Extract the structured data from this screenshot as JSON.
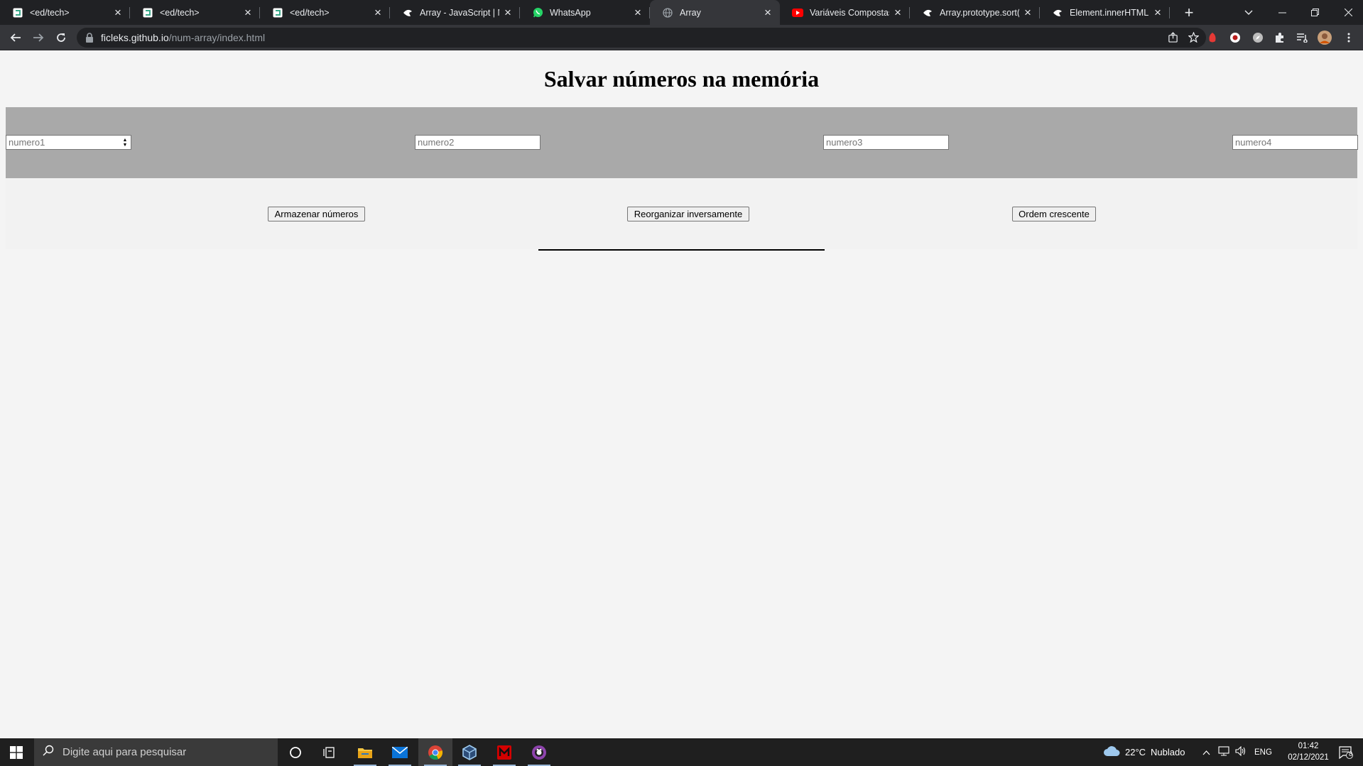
{
  "browser": {
    "tabs": [
      {
        "title": "<ed/tech>",
        "favicon": "edtech-icon",
        "active": false
      },
      {
        "title": "<ed/tech>",
        "favicon": "edtech-icon",
        "active": false
      },
      {
        "title": "<ed/tech>",
        "favicon": "edtech-icon",
        "active": false
      },
      {
        "title": "Array - JavaScript | MDN",
        "favicon": "mdn-icon",
        "active": false
      },
      {
        "title": "WhatsApp",
        "favicon": "whatsapp-icon",
        "active": false
      },
      {
        "title": "Array",
        "favicon": "globe-icon",
        "active": true
      },
      {
        "title": "Variáveis Compostas - ",
        "favicon": "youtube-icon",
        "active": false
      },
      {
        "title": "Array.prototype.sort()",
        "favicon": "mdn-icon",
        "active": false
      },
      {
        "title": "Element.innerHTML - ",
        "favicon": "mdn-icon",
        "active": false
      }
    ],
    "url": {
      "domain": "ficleks.github.io",
      "path": "/num-array/index.html"
    }
  },
  "page": {
    "title": "Salvar números na memória",
    "inputs": [
      {
        "placeholder": "numero1",
        "focused": true
      },
      {
        "placeholder": "numero2"
      },
      {
        "placeholder": "numero3"
      },
      {
        "placeholder": "numero4"
      }
    ],
    "buttons": [
      {
        "label": "Armazenar números"
      },
      {
        "label": "Reorganizar inversamente"
      },
      {
        "label": "Ordem crescente"
      }
    ]
  },
  "taskbar": {
    "search_placeholder": "Digite aqui para pesquisar",
    "weather": {
      "temp": "22°C",
      "condition": "Nublado"
    },
    "language": "ENG",
    "time": "01:42",
    "date": "02/12/2021",
    "notifications": "8"
  },
  "colors": {
    "tabstrip": "#202124",
    "active_tab": "#35363a",
    "input_band": "#a9a9a9",
    "page_bg": "#f4f4f4"
  }
}
